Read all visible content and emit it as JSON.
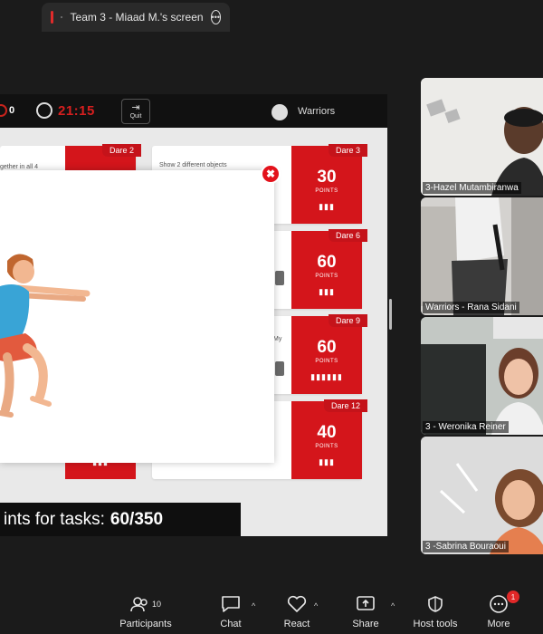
{
  "top_tab": {
    "title": "Team 3 - Miaad M.'s screen"
  },
  "game": {
    "score": "0",
    "timer": "21:15",
    "quit_label": "Quit",
    "team_name": "Warriors",
    "points_label": "ints for tasks:",
    "points_value": "60/350",
    "card_texts": [
      "gether in all 4",
      "Show 2 different objects",
      "My"
    ]
  },
  "dares": [
    {
      "tag": "Dare 2",
      "points": "",
      "unit": "",
      "people": "",
      "color": "#1e9a3b"
    },
    {
      "tag": "Dare 3",
      "points": "30",
      "unit": "POINTS",
      "people": "▮▮▮",
      "color": "#d4151b"
    },
    {
      "tag": "Dare 6",
      "points": "60",
      "unit": "POINTS",
      "people": "▮▮▮",
      "color": "#595959"
    },
    {
      "tag": "Dare 9",
      "points": "60",
      "unit": "POINTS",
      "people": "▮▮▮▮▮▮",
      "color": "#d4151b"
    },
    {
      "tag": "Dare 12",
      "points": "40",
      "unit": "POINTS",
      "people": "▮▮▮",
      "color": "#d4151b"
    },
    {
      "tag": "",
      "points": "",
      "unit": "",
      "people": "▮▮▮",
      "color": "#d4151b"
    }
  ],
  "participants": [
    {
      "name": "3-Hazel Mutambiranwa"
    },
    {
      "name": "Warriors - Rana Sidani"
    },
    {
      "name": "3 - Weronika Reiner"
    },
    {
      "name": "3 -Sabrina Bouraoui"
    }
  ],
  "toolbar": {
    "participants_label": "Participants",
    "participants_count": "10",
    "chat_label": "Chat",
    "react_label": "React",
    "share_label": "Share",
    "host_tools_label": "Host tools",
    "more_label": "More",
    "more_badge": "1"
  },
  "icons": {
    "close": "close-icon",
    "timer": "stopwatch-icon",
    "quit": "exit-icon",
    "team": "team-icon"
  },
  "colors": {
    "accent_red": "#d4151b",
    "dark_bg": "#1b1b1b"
  }
}
